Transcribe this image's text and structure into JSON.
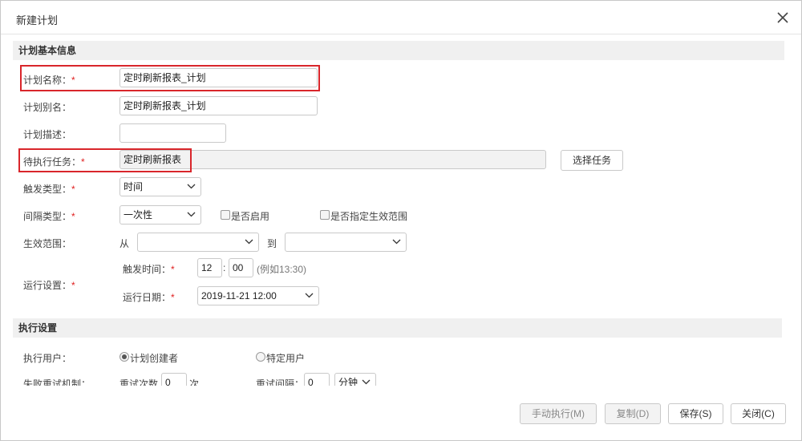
{
  "dialog": {
    "title": "新建计划"
  },
  "basic_section": {
    "title": "计划基本信息"
  },
  "plan_name": {
    "label": "计划名称：",
    "required": "*",
    "value": "定时刷新报表_计划"
  },
  "plan_alias": {
    "label": "计划别名：",
    "value": "定时刷新报表_计划"
  },
  "plan_desc": {
    "label": "计划描述：",
    "value": ""
  },
  "pending_task": {
    "label": "待执行任务：",
    "required": "*",
    "value": "定时刷新报表",
    "choose_button": "选择任务"
  },
  "trigger_type": {
    "label": "触发类型：",
    "required": "*",
    "value": "时间"
  },
  "interval_type": {
    "label": "间隔类型：",
    "required": "*",
    "value": "一次性",
    "enable_label": "是否启用",
    "scope_label": "是否指定生效范围"
  },
  "effective_range": {
    "label": "生效范围：",
    "from": "从",
    "to": "到",
    "from_value": "",
    "to_value": ""
  },
  "run_settings": {
    "label": "运行设置：",
    "required": "*",
    "trigger_time_label": "触发时间：",
    "hour": "12",
    "minute": "00",
    "separator": ":",
    "hint": "(例如13:30)",
    "run_date_label": "运行日期：",
    "run_date": "2019-11-21 12:00"
  },
  "exec_section": {
    "title": "执行设置"
  },
  "exec_user": {
    "label": "执行用户：",
    "option_creator": "计划创建者",
    "option_specific": "特定用户",
    "selected": "creator"
  },
  "retry": {
    "label": "失败重试机制：",
    "count_label": "重试次数",
    "count_value": "0",
    "count_unit": "次",
    "interval_label": "重试间隔：",
    "interval_value": "0",
    "interval_unit": "分钟"
  },
  "footer": {
    "manual_run": "手动执行(M)",
    "copy": "复制(D)",
    "save": "保存(S)",
    "close": "关闭(C)"
  },
  "colors": {
    "highlight": "#d9262b",
    "required": "#e02020",
    "section_bg": "#f0f0f0"
  },
  "icons": {
    "close": "close-icon",
    "dropdown": "chevron-down-icon"
  }
}
